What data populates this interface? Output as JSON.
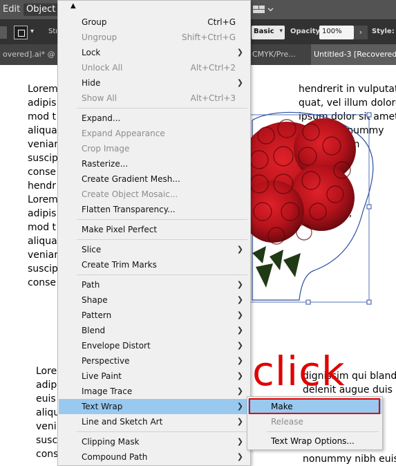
{
  "menubar": {
    "items": [
      "Edit",
      "Object"
    ]
  },
  "control_bar": {
    "stroke_label": "Stroke",
    "style_preset": "Basic",
    "opacity_label": "Opacity:",
    "opacity_value": "100%",
    "style_label": "Style:"
  },
  "tabs": [
    "overed].ai* @ 60",
    "CMYK/Pre...",
    "Untitled-3 [Recovered]"
  ],
  "document": {
    "left_top": "Lorem\nadipis\nmod t\naliqua\nvenian\nsuscip\nconse\nhendr\nLorem\nadipis\nmod t\naliqua\nvenian\nsuscip\nconse",
    "right_top": "hendrerit in vulputat\nquat, vel illum dolore\nipsum dolor sit amet\nd diam nonummy\ndolore magn\nd minim v\nper su\nodo con\nn hendre\nconsequat,",
    "left_bottom": "Lore\nadip\neuis\naliqu\nveni\nsusc\ncons",
    "right_bottom": "dignissim qui bland\ndelenit augue duis d\n\n\n\n\nnonummy nibh euis"
  },
  "annotation": {
    "text": "click",
    "color": "#e00000"
  },
  "object_menu": {
    "items": [
      {
        "label": "Group",
        "shortcut": "Ctrl+G",
        "disabled": false,
        "submenu": false
      },
      {
        "label": "Ungroup",
        "shortcut": "Shift+Ctrl+G",
        "disabled": true,
        "submenu": false
      },
      {
        "label": "Lock",
        "shortcut": "",
        "disabled": false,
        "submenu": true
      },
      {
        "label": "Unlock All",
        "shortcut": "Alt+Ctrl+2",
        "disabled": true,
        "submenu": false
      },
      {
        "label": "Hide",
        "shortcut": "",
        "disabled": false,
        "submenu": true
      },
      {
        "label": "Show All",
        "shortcut": "Alt+Ctrl+3",
        "disabled": true,
        "submenu": false
      },
      {
        "label": "Expand...",
        "shortcut": "",
        "disabled": false,
        "submenu": false
      },
      {
        "label": "Expand Appearance",
        "shortcut": "",
        "disabled": true,
        "submenu": false
      },
      {
        "label": "Crop Image",
        "shortcut": "",
        "disabled": true,
        "submenu": false
      },
      {
        "label": "Rasterize...",
        "shortcut": "",
        "disabled": false,
        "submenu": false
      },
      {
        "label": "Create Gradient Mesh...",
        "shortcut": "",
        "disabled": false,
        "submenu": false
      },
      {
        "label": "Create Object Mosaic...",
        "shortcut": "",
        "disabled": true,
        "submenu": false
      },
      {
        "label": "Flatten Transparency...",
        "shortcut": "",
        "disabled": false,
        "submenu": false
      },
      {
        "label": "Make Pixel Perfect",
        "shortcut": "",
        "disabled": false,
        "submenu": false
      },
      {
        "label": "Slice",
        "shortcut": "",
        "disabled": false,
        "submenu": true
      },
      {
        "label": "Create Trim Marks",
        "shortcut": "",
        "disabled": false,
        "submenu": false
      },
      {
        "label": "Path",
        "shortcut": "",
        "disabled": false,
        "submenu": true
      },
      {
        "label": "Shape",
        "shortcut": "",
        "disabled": false,
        "submenu": true
      },
      {
        "label": "Pattern",
        "shortcut": "",
        "disabled": false,
        "submenu": true
      },
      {
        "label": "Blend",
        "shortcut": "",
        "disabled": false,
        "submenu": true
      },
      {
        "label": "Envelope Distort",
        "shortcut": "",
        "disabled": false,
        "submenu": true
      },
      {
        "label": "Perspective",
        "shortcut": "",
        "disabled": false,
        "submenu": true
      },
      {
        "label": "Live Paint",
        "shortcut": "",
        "disabled": false,
        "submenu": true
      },
      {
        "label": "Image Trace",
        "shortcut": "",
        "disabled": false,
        "submenu": true
      },
      {
        "label": "Text Wrap",
        "shortcut": "",
        "disabled": false,
        "submenu": true,
        "highlighted": true
      },
      {
        "label": "Line and Sketch Art",
        "shortcut": "",
        "disabled": false,
        "submenu": true
      },
      {
        "label": "Clipping Mask",
        "shortcut": "",
        "disabled": false,
        "submenu": true
      },
      {
        "label": "Compound Path",
        "shortcut": "",
        "disabled": false,
        "submenu": true
      }
    ]
  },
  "text_wrap_submenu": {
    "items": [
      {
        "label": "Make",
        "disabled": false,
        "highlighted": true
      },
      {
        "label": "Release",
        "disabled": true
      },
      {
        "label": "Text Wrap Options...",
        "disabled": false
      }
    ]
  },
  "colors": {
    "menubar": "#535353",
    "menu_bg": "#f0f0f0",
    "highlight": "#99c9ef",
    "selection": "#2b4fa0",
    "annotation": "#e00000"
  }
}
